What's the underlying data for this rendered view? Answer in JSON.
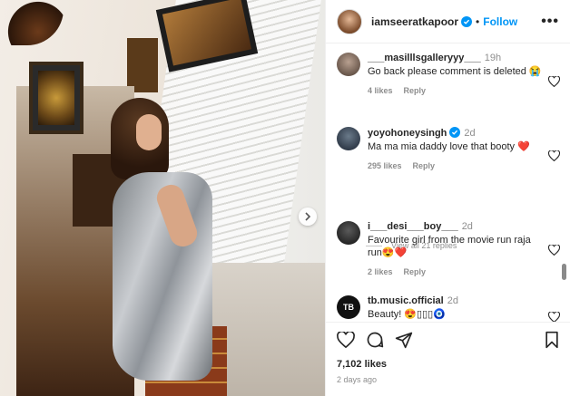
{
  "post": {
    "author": "iamseeratkapoor",
    "follow_label": "Follow",
    "separator": "•",
    "likes": "7,102 likes",
    "date": "2 days ago"
  },
  "comments": [
    {
      "user": "___masilllsgalleryyy___",
      "time": "19h",
      "text": "Go back please comment is deleted 😭",
      "likes": "4 likes",
      "reply": "Reply"
    },
    {
      "user": "yoyohoneysingh",
      "time": "2d",
      "text": "Ma ma mia daddy love that booty ❤️",
      "likes": "295 likes",
      "reply": "Reply",
      "verified": true
    },
    {
      "user": "i___desi___boy___",
      "time": "2d",
      "text": "Favourite girl from the movie run raja run😍❤️",
      "likes": "2 likes",
      "reply": "Reply"
    },
    {
      "user": "tb.music.official",
      "time": "2d",
      "text": "Beauty! 😍▯▯▯🧿",
      "likes": "",
      "reply": ""
    }
  ],
  "view_all": "View all 21 replies",
  "icons": [
    "verified-badge-icon",
    "more-options-icon",
    "next-image-icon",
    "heart-icon",
    "comment-icon",
    "share-icon",
    "bookmark-icon"
  ],
  "colors": {
    "accent": "#0095f6",
    "heart_red": "#ed4956",
    "muted": "#8e8e8e"
  }
}
